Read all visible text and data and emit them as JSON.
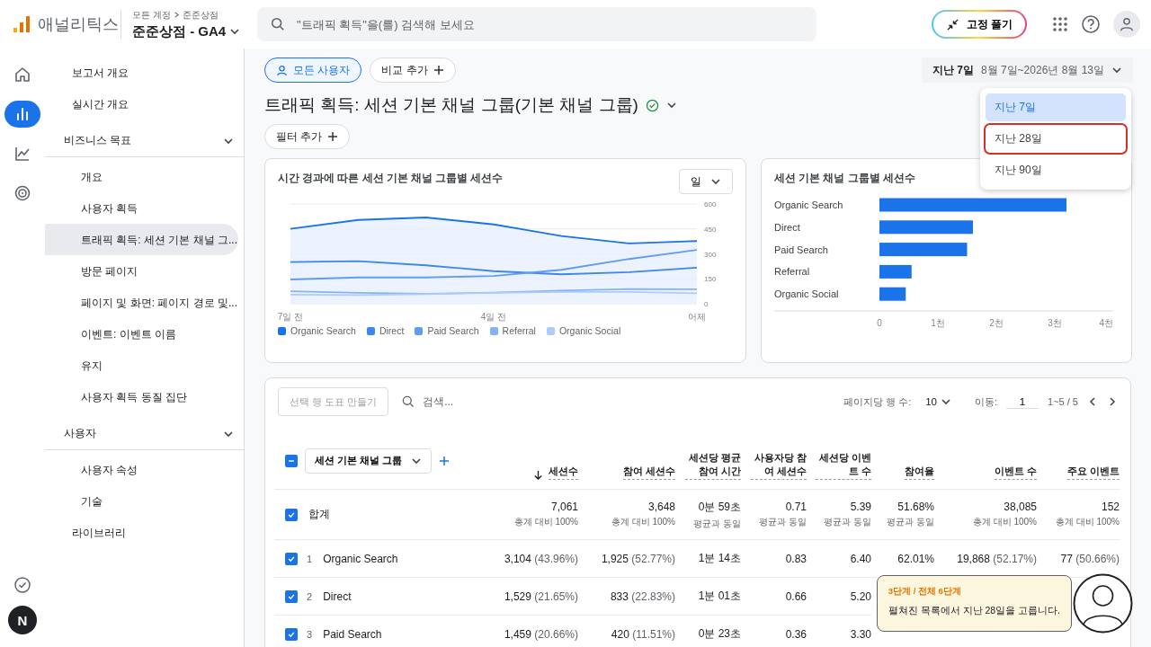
{
  "header": {
    "product": "애널리틱스",
    "breadcrumb": [
      "모든 계정",
      "준준상점"
    ],
    "property": "준준상점 - GA4",
    "search_placeholder": "\"트래픽 획득\"을(를) 검색해 보세요",
    "pin_button": "고정 풀기"
  },
  "rail": [
    {
      "kind": "home",
      "selected": false
    },
    {
      "kind": "reports",
      "selected": true
    },
    {
      "kind": "explore",
      "selected": false
    },
    {
      "kind": "advertising",
      "selected": false
    }
  ],
  "rail_bottom": [
    {
      "kind": "check"
    },
    {
      "kind": "avatar",
      "text": "N"
    }
  ],
  "nav": [
    {
      "label": "보고서 개요",
      "selected": false
    },
    {
      "label": "실시간 개요",
      "selected": false
    },
    {
      "label": "비즈니스 목표",
      "expanded": true,
      "children": [
        {
          "label": "개요",
          "selected": false
        },
        {
          "label": "사용자 획득",
          "selected": false
        },
        {
          "label": "트래픽 획득: 세션 기본 채널 그...",
          "selected": true
        },
        {
          "label": "방문 페이지",
          "selected": false
        },
        {
          "label": "페이지 및 화면: 페이지 경로 및...",
          "selected": false
        },
        {
          "label": "이벤트: 이벤트 이름",
          "selected": false
        },
        {
          "label": "유지",
          "selected": false
        },
        {
          "label": "사용자 획득 동질 집단",
          "selected": false
        }
      ]
    },
    {
      "label": "사용자",
      "expanded": true,
      "children": [
        {
          "label": "사용자 속성",
          "selected": false
        },
        {
          "label": "기술",
          "selected": false
        }
      ]
    },
    {
      "label": "라이브러리",
      "selected": false
    }
  ],
  "segments": [
    {
      "label": "모든 사용자",
      "kind": "segment"
    },
    {
      "label": "비교 추가",
      "kind": "add"
    }
  ],
  "date_range": {
    "preset": "지난 7일",
    "dates": "8월 7일~2026년 8월 13일"
  },
  "date_menu": [
    {
      "label": "지난 7일",
      "selected": true,
      "highlighted": false
    },
    {
      "label": "지난 28일",
      "selected": false,
      "highlighted": true
    },
    {
      "label": "지난 90일",
      "selected": false,
      "highlighted": false
    }
  ],
  "page_title": "트래픽 획득: 세션 기본 채널 그룹(기본 채널 그룹)",
  "filter_button": "필터 추가",
  "line_card": {
    "title": "시간 경과에 따른 세션 기본 채널 그룹별 세션수",
    "interval": "일",
    "chart_data": {
      "type": "line",
      "categories": [
        "7일 전",
        null,
        null,
        "4일 전",
        null,
        null,
        "어제"
      ],
      "ylim": [
        0,
        600
      ],
      "yticks": [
        0,
        150,
        300,
        450,
        600
      ],
      "series": [
        {
          "name": "Organic Search",
          "color": "#1a73e8",
          "values": [
            451,
            504,
            519,
            477,
            408,
            363,
            377
          ]
        },
        {
          "name": "Direct",
          "color": "#3d86f0",
          "values": [
            251,
            256,
            231,
            196,
            177,
            190,
            217
          ]
        },
        {
          "name": "Paid Search",
          "color": "#5e9cf5",
          "values": [
            146,
            158,
            158,
            167,
            204,
            269,
            324
          ]
        },
        {
          "name": "Referral",
          "color": "#86b3f7",
          "values": [
            75,
            65,
            60,
            67,
            79,
            88,
            87
          ]
        },
        {
          "name": "Organic Social",
          "color": "#aecbfa",
          "values": [
            55,
            52,
            58,
            65,
            71,
            71,
            63
          ]
        }
      ]
    }
  },
  "bar_card": {
    "title": "세션 기본 채널 그룹별 세션수",
    "chart_data": {
      "type": "bar",
      "orientation": "horizontal",
      "categories": [
        "Organic Search",
        "Direct",
        "Paid Search",
        "Referral",
        "Organic Social"
      ],
      "values": [
        3.2,
        1.6,
        1.5,
        0.55,
        0.45
      ],
      "xlim": [
        0,
        4
      ],
      "xticks": [
        {
          "value": 0,
          "label": "0"
        },
        {
          "value": 1,
          "label": "1천"
        },
        {
          "value": 2,
          "label": "2천"
        },
        {
          "value": 3,
          "label": "3천"
        },
        {
          "value": 4,
          "label": "4천"
        }
      ]
    }
  },
  "table": {
    "chart_button": "선택 행 도표 만들기",
    "search_placeholder": "검색...",
    "rows_per_page_label": "페이지당 행 수:",
    "rows_per_page": "10",
    "goto_label": "이동:",
    "page": "1",
    "range": "1~5 / 5",
    "select_all_partial": true,
    "dimension": "세션 기본 채널 그룹",
    "columns": [
      {
        "label": "세션수",
        "sorted": true
      },
      {
        "label": "참여 세션수",
        "sorted": false
      },
      {
        "label": "세션당 평균 참여 시간",
        "sorted": false
      },
      {
        "label": "사용자당 참여 세션수",
        "sorted": false
      },
      {
        "label": "세션당 이벤트 수",
        "sorted": false
      },
      {
        "label": "참여율",
        "sorted": false
      },
      {
        "label": "이벤트 수",
        "sorted": false
      },
      {
        "label": "주요 이벤트",
        "sorted": false
      }
    ],
    "total": {
      "checked": true,
      "label": "합계",
      "cells": [
        {
          "value": "7,061",
          "note": "총계 대비 100%"
        },
        {
          "value": "3,648",
          "note": "총계 대비 100%"
        },
        {
          "value": "0분 59초",
          "note": "평균과 동일"
        },
        {
          "value": "0.71",
          "note": "평균과 동일"
        },
        {
          "value": "5.39",
          "note": "평균과 동일"
        },
        {
          "value": "51.68%",
          "note": "평균과 동일"
        },
        {
          "value": "38,085",
          "note": "총계 대비 100%"
        },
        {
          "value": "152",
          "note": "총계 대비 100%"
        }
      ]
    },
    "rows": [
      {
        "index": "1",
        "name": "Organic Search",
        "checked": true,
        "cells": [
          {
            "value": "3,104",
            "share": "(43.96%)"
          },
          {
            "value": "1,925",
            "share": "(52.77%)"
          },
          {
            "value": "1분 14초"
          },
          {
            "value": "0.83"
          },
          {
            "value": "6.40"
          },
          {
            "value": "62.01%"
          },
          {
            "value": "19,868",
            "share": "(52.17%)"
          },
          {
            "value": "77",
            "share": "(50.66%)"
          }
        ]
      },
      {
        "index": "2",
        "name": "Direct",
        "checked": true,
        "cells": [
          {
            "value": "1,529",
            "share": "(21.65%)"
          },
          {
            "value": "833",
            "share": "(22.83%)"
          },
          {
            "value": "1분 01초"
          },
          {
            "value": "0.66"
          },
          {
            "value": "5.20"
          }
        ]
      },
      {
        "index": "3",
        "name": "Paid Search",
        "checked": true,
        "cells": [
          {
            "value": "1,459",
            "share": "(20.66%)"
          },
          {
            "value": "420",
            "share": "(11.51%)"
          },
          {
            "value": "0분 23초"
          },
          {
            "value": "0.36"
          },
          {
            "value": "3.30"
          }
        ]
      }
    ]
  },
  "guide": {
    "step": "3단계 / 전체 6단계",
    "message": "펼쳐진 목록에서 지난 28일을 고릅니다."
  }
}
